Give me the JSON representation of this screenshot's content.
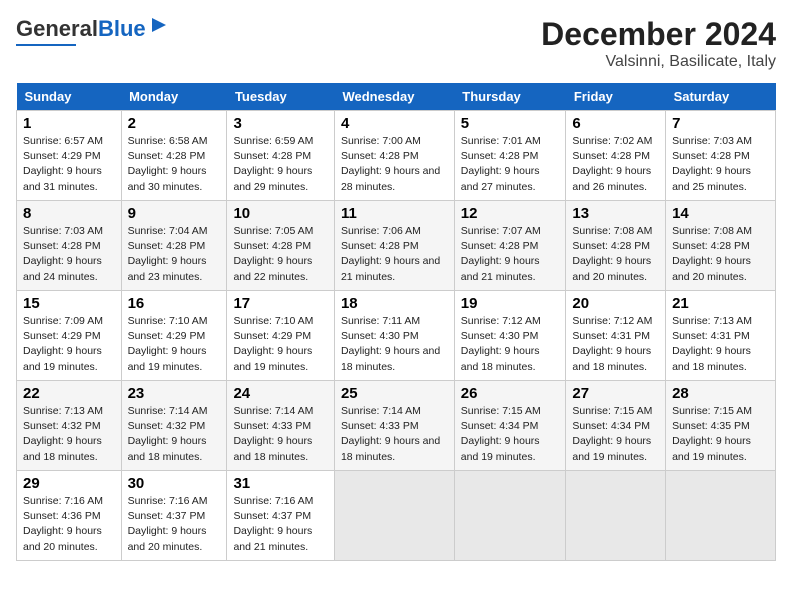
{
  "header": {
    "logo_general": "General",
    "logo_blue": "Blue",
    "title": "December 2024",
    "subtitle": "Valsinni, Basilicate, Italy"
  },
  "days_of_week": [
    "Sunday",
    "Monday",
    "Tuesday",
    "Wednesday",
    "Thursday",
    "Friday",
    "Saturday"
  ],
  "weeks": [
    [
      {
        "day": "1",
        "sunrise": "Sunrise: 6:57 AM",
        "sunset": "Sunset: 4:29 PM",
        "daylight": "Daylight: 9 hours and 31 minutes."
      },
      {
        "day": "2",
        "sunrise": "Sunrise: 6:58 AM",
        "sunset": "Sunset: 4:28 PM",
        "daylight": "Daylight: 9 hours and 30 minutes."
      },
      {
        "day": "3",
        "sunrise": "Sunrise: 6:59 AM",
        "sunset": "Sunset: 4:28 PM",
        "daylight": "Daylight: 9 hours and 29 minutes."
      },
      {
        "day": "4",
        "sunrise": "Sunrise: 7:00 AM",
        "sunset": "Sunset: 4:28 PM",
        "daylight": "Daylight: 9 hours and 28 minutes."
      },
      {
        "day": "5",
        "sunrise": "Sunrise: 7:01 AM",
        "sunset": "Sunset: 4:28 PM",
        "daylight": "Daylight: 9 hours and 27 minutes."
      },
      {
        "day": "6",
        "sunrise": "Sunrise: 7:02 AM",
        "sunset": "Sunset: 4:28 PM",
        "daylight": "Daylight: 9 hours and 26 minutes."
      },
      {
        "day": "7",
        "sunrise": "Sunrise: 7:03 AM",
        "sunset": "Sunset: 4:28 PM",
        "daylight": "Daylight: 9 hours and 25 minutes."
      }
    ],
    [
      {
        "day": "8",
        "sunrise": "Sunrise: 7:03 AM",
        "sunset": "Sunset: 4:28 PM",
        "daylight": "Daylight: 9 hours and 24 minutes."
      },
      {
        "day": "9",
        "sunrise": "Sunrise: 7:04 AM",
        "sunset": "Sunset: 4:28 PM",
        "daylight": "Daylight: 9 hours and 23 minutes."
      },
      {
        "day": "10",
        "sunrise": "Sunrise: 7:05 AM",
        "sunset": "Sunset: 4:28 PM",
        "daylight": "Daylight: 9 hours and 22 minutes."
      },
      {
        "day": "11",
        "sunrise": "Sunrise: 7:06 AM",
        "sunset": "Sunset: 4:28 PM",
        "daylight": "Daylight: 9 hours and 21 minutes."
      },
      {
        "day": "12",
        "sunrise": "Sunrise: 7:07 AM",
        "sunset": "Sunset: 4:28 PM",
        "daylight": "Daylight: 9 hours and 21 minutes."
      },
      {
        "day": "13",
        "sunrise": "Sunrise: 7:08 AM",
        "sunset": "Sunset: 4:28 PM",
        "daylight": "Daylight: 9 hours and 20 minutes."
      },
      {
        "day": "14",
        "sunrise": "Sunrise: 7:08 AM",
        "sunset": "Sunset: 4:28 PM",
        "daylight": "Daylight: 9 hours and 20 minutes."
      }
    ],
    [
      {
        "day": "15",
        "sunrise": "Sunrise: 7:09 AM",
        "sunset": "Sunset: 4:29 PM",
        "daylight": "Daylight: 9 hours and 19 minutes."
      },
      {
        "day": "16",
        "sunrise": "Sunrise: 7:10 AM",
        "sunset": "Sunset: 4:29 PM",
        "daylight": "Daylight: 9 hours and 19 minutes."
      },
      {
        "day": "17",
        "sunrise": "Sunrise: 7:10 AM",
        "sunset": "Sunset: 4:29 PM",
        "daylight": "Daylight: 9 hours and 19 minutes."
      },
      {
        "day": "18",
        "sunrise": "Sunrise: 7:11 AM",
        "sunset": "Sunset: 4:30 PM",
        "daylight": "Daylight: 9 hours and 18 minutes."
      },
      {
        "day": "19",
        "sunrise": "Sunrise: 7:12 AM",
        "sunset": "Sunset: 4:30 PM",
        "daylight": "Daylight: 9 hours and 18 minutes."
      },
      {
        "day": "20",
        "sunrise": "Sunrise: 7:12 AM",
        "sunset": "Sunset: 4:31 PM",
        "daylight": "Daylight: 9 hours and 18 minutes."
      },
      {
        "day": "21",
        "sunrise": "Sunrise: 7:13 AM",
        "sunset": "Sunset: 4:31 PM",
        "daylight": "Daylight: 9 hours and 18 minutes."
      }
    ],
    [
      {
        "day": "22",
        "sunrise": "Sunrise: 7:13 AM",
        "sunset": "Sunset: 4:32 PM",
        "daylight": "Daylight: 9 hours and 18 minutes."
      },
      {
        "day": "23",
        "sunrise": "Sunrise: 7:14 AM",
        "sunset": "Sunset: 4:32 PM",
        "daylight": "Daylight: 9 hours and 18 minutes."
      },
      {
        "day": "24",
        "sunrise": "Sunrise: 7:14 AM",
        "sunset": "Sunset: 4:33 PM",
        "daylight": "Daylight: 9 hours and 18 minutes."
      },
      {
        "day": "25",
        "sunrise": "Sunrise: 7:14 AM",
        "sunset": "Sunset: 4:33 PM",
        "daylight": "Daylight: 9 hours and 18 minutes."
      },
      {
        "day": "26",
        "sunrise": "Sunrise: 7:15 AM",
        "sunset": "Sunset: 4:34 PM",
        "daylight": "Daylight: 9 hours and 19 minutes."
      },
      {
        "day": "27",
        "sunrise": "Sunrise: 7:15 AM",
        "sunset": "Sunset: 4:34 PM",
        "daylight": "Daylight: 9 hours and 19 minutes."
      },
      {
        "day": "28",
        "sunrise": "Sunrise: 7:15 AM",
        "sunset": "Sunset: 4:35 PM",
        "daylight": "Daylight: 9 hours and 19 minutes."
      }
    ],
    [
      {
        "day": "29",
        "sunrise": "Sunrise: 7:16 AM",
        "sunset": "Sunset: 4:36 PM",
        "daylight": "Daylight: 9 hours and 20 minutes."
      },
      {
        "day": "30",
        "sunrise": "Sunrise: 7:16 AM",
        "sunset": "Sunset: 4:37 PM",
        "daylight": "Daylight: 9 hours and 20 minutes."
      },
      {
        "day": "31",
        "sunrise": "Sunrise: 7:16 AM",
        "sunset": "Sunset: 4:37 PM",
        "daylight": "Daylight: 9 hours and 21 minutes."
      },
      null,
      null,
      null,
      null
    ]
  ]
}
